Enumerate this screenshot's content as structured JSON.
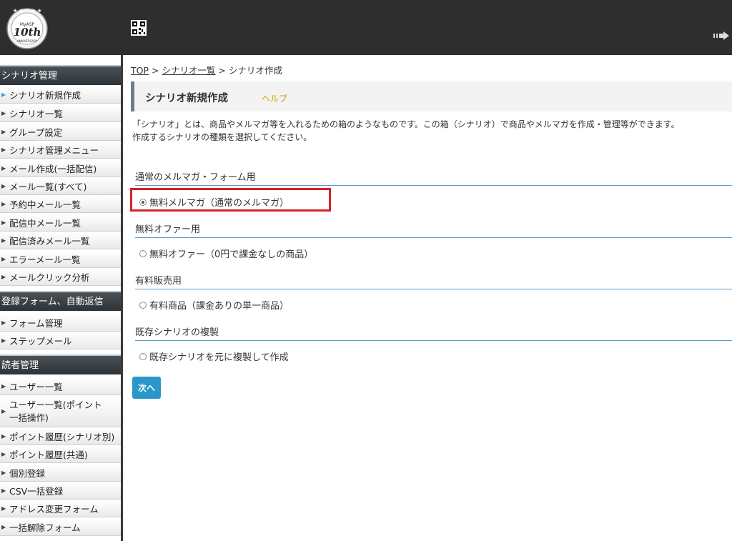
{
  "header": {
    "logo_text": "MyASP 10th ANNIVERSARY",
    "logout_label": "ログアウト"
  },
  "sidebar": {
    "sections": [
      {
        "title": "シナリオ管理",
        "items": [
          "シナリオ新規作成",
          "シナリオ一覧",
          "グループ設定",
          "シナリオ管理メニュー",
          "メール作成(一括配信)",
          "メール一覧(すべて)",
          "予約中メール一覧",
          "配信中メール一覧",
          "配信済みメール一覧",
          "エラーメール一覧",
          "メールクリック分析"
        ]
      },
      {
        "title": "登録フォーム、自動返信",
        "items": [
          "フォーム管理",
          "ステップメール"
        ]
      },
      {
        "title": "読者管理",
        "items": [
          "ユーザー一覧",
          "ユーザー一覧(ポイント一括操作)",
          "ポイント履歴(シナリオ別)",
          "ポイント履歴(共通)",
          "個別登録",
          "CSV一括登録",
          "アドレス変更フォーム",
          "一括解除フォーム"
        ]
      }
    ]
  },
  "breadcrumb": {
    "top": "TOP",
    "list": "シナリオ一覧",
    "sep": " > ",
    "current": "シナリオ作成"
  },
  "page": {
    "title": "シナリオ新規作成",
    "help": "ヘルプ",
    "desc1": "「シナリオ」とは、商品やメルマガ等を入れるための箱のようなものです。この箱（シナリオ）で商品やメルマガを作成・管理等ができます。",
    "desc2": "作成するシナリオの種類を選択してください。"
  },
  "groups": [
    {
      "heading": "通常のメルマガ・フォーム用",
      "option": "無料メルマガ（通常のメルマガ）",
      "checked": true
    },
    {
      "heading": "無料オファー用",
      "option": "無料オファー（0円で課金なしの商品）",
      "checked": false
    },
    {
      "heading": "有料販売用",
      "option": "有料商品（課金ありの単一商品）",
      "checked": false
    },
    {
      "heading": "既存シナリオの複製",
      "option": "既存シナリオを元に複製して作成",
      "checked": false
    }
  ],
  "next_label": "次へ",
  "colors": {
    "header_bg": "#2e2e2e",
    "accent": "#2a96c9",
    "highlight": "#d9212c",
    "help": "#d4a200"
  }
}
